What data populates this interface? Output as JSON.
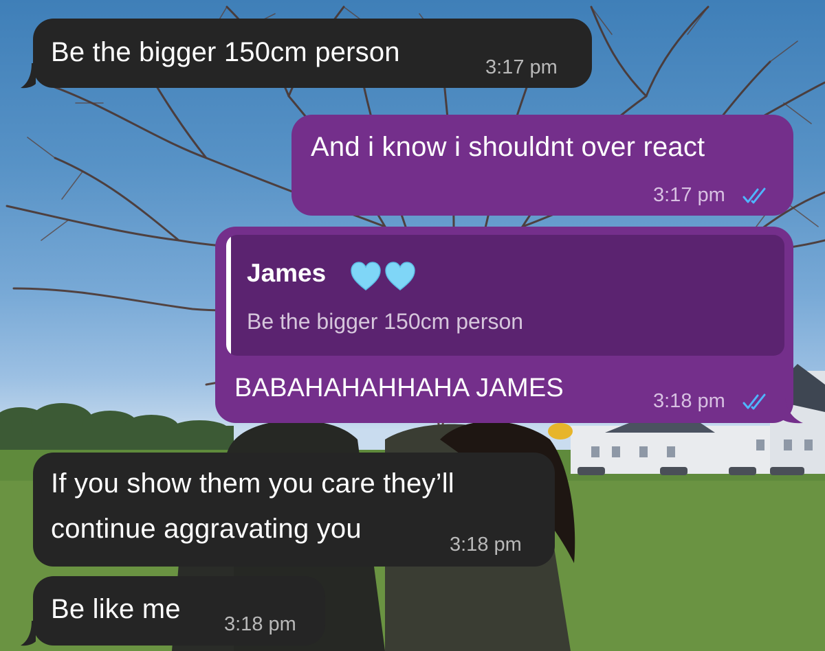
{
  "conversation": {
    "messages": [
      {
        "direction": "incoming",
        "text": "Be the bigger 150cm person",
        "time": "3:17 pm"
      },
      {
        "direction": "outgoing",
        "text": "And i know i shouldnt over react",
        "time": "3:17 pm",
        "status": "read-double-tick"
      },
      {
        "direction": "outgoing",
        "reply_to": {
          "author": "James",
          "author_emoji": "💙💙",
          "text": "Be the bigger 150cm person"
        },
        "text": "BABAHAHAHHAHA JAMES",
        "time": "3:18 pm",
        "status": "read-double-tick"
      },
      {
        "direction": "incoming",
        "text_lines": [
          "If you show them you care they’ll",
          "continue aggravating you"
        ],
        "time": "3:18 pm"
      },
      {
        "direction": "incoming",
        "text": "Be like me",
        "time": "3:18 pm"
      }
    ]
  },
  "colors": {
    "incoming_bubble": "#252525",
    "outgoing_bubble": "#742f8b",
    "reply_box": "#5b2370",
    "read_ticks": "#4fb6ff",
    "heart": "#7fd6f7"
  },
  "icons": {
    "read_receipt": "double-check-icon",
    "heart": "light-blue-heart-icon"
  }
}
